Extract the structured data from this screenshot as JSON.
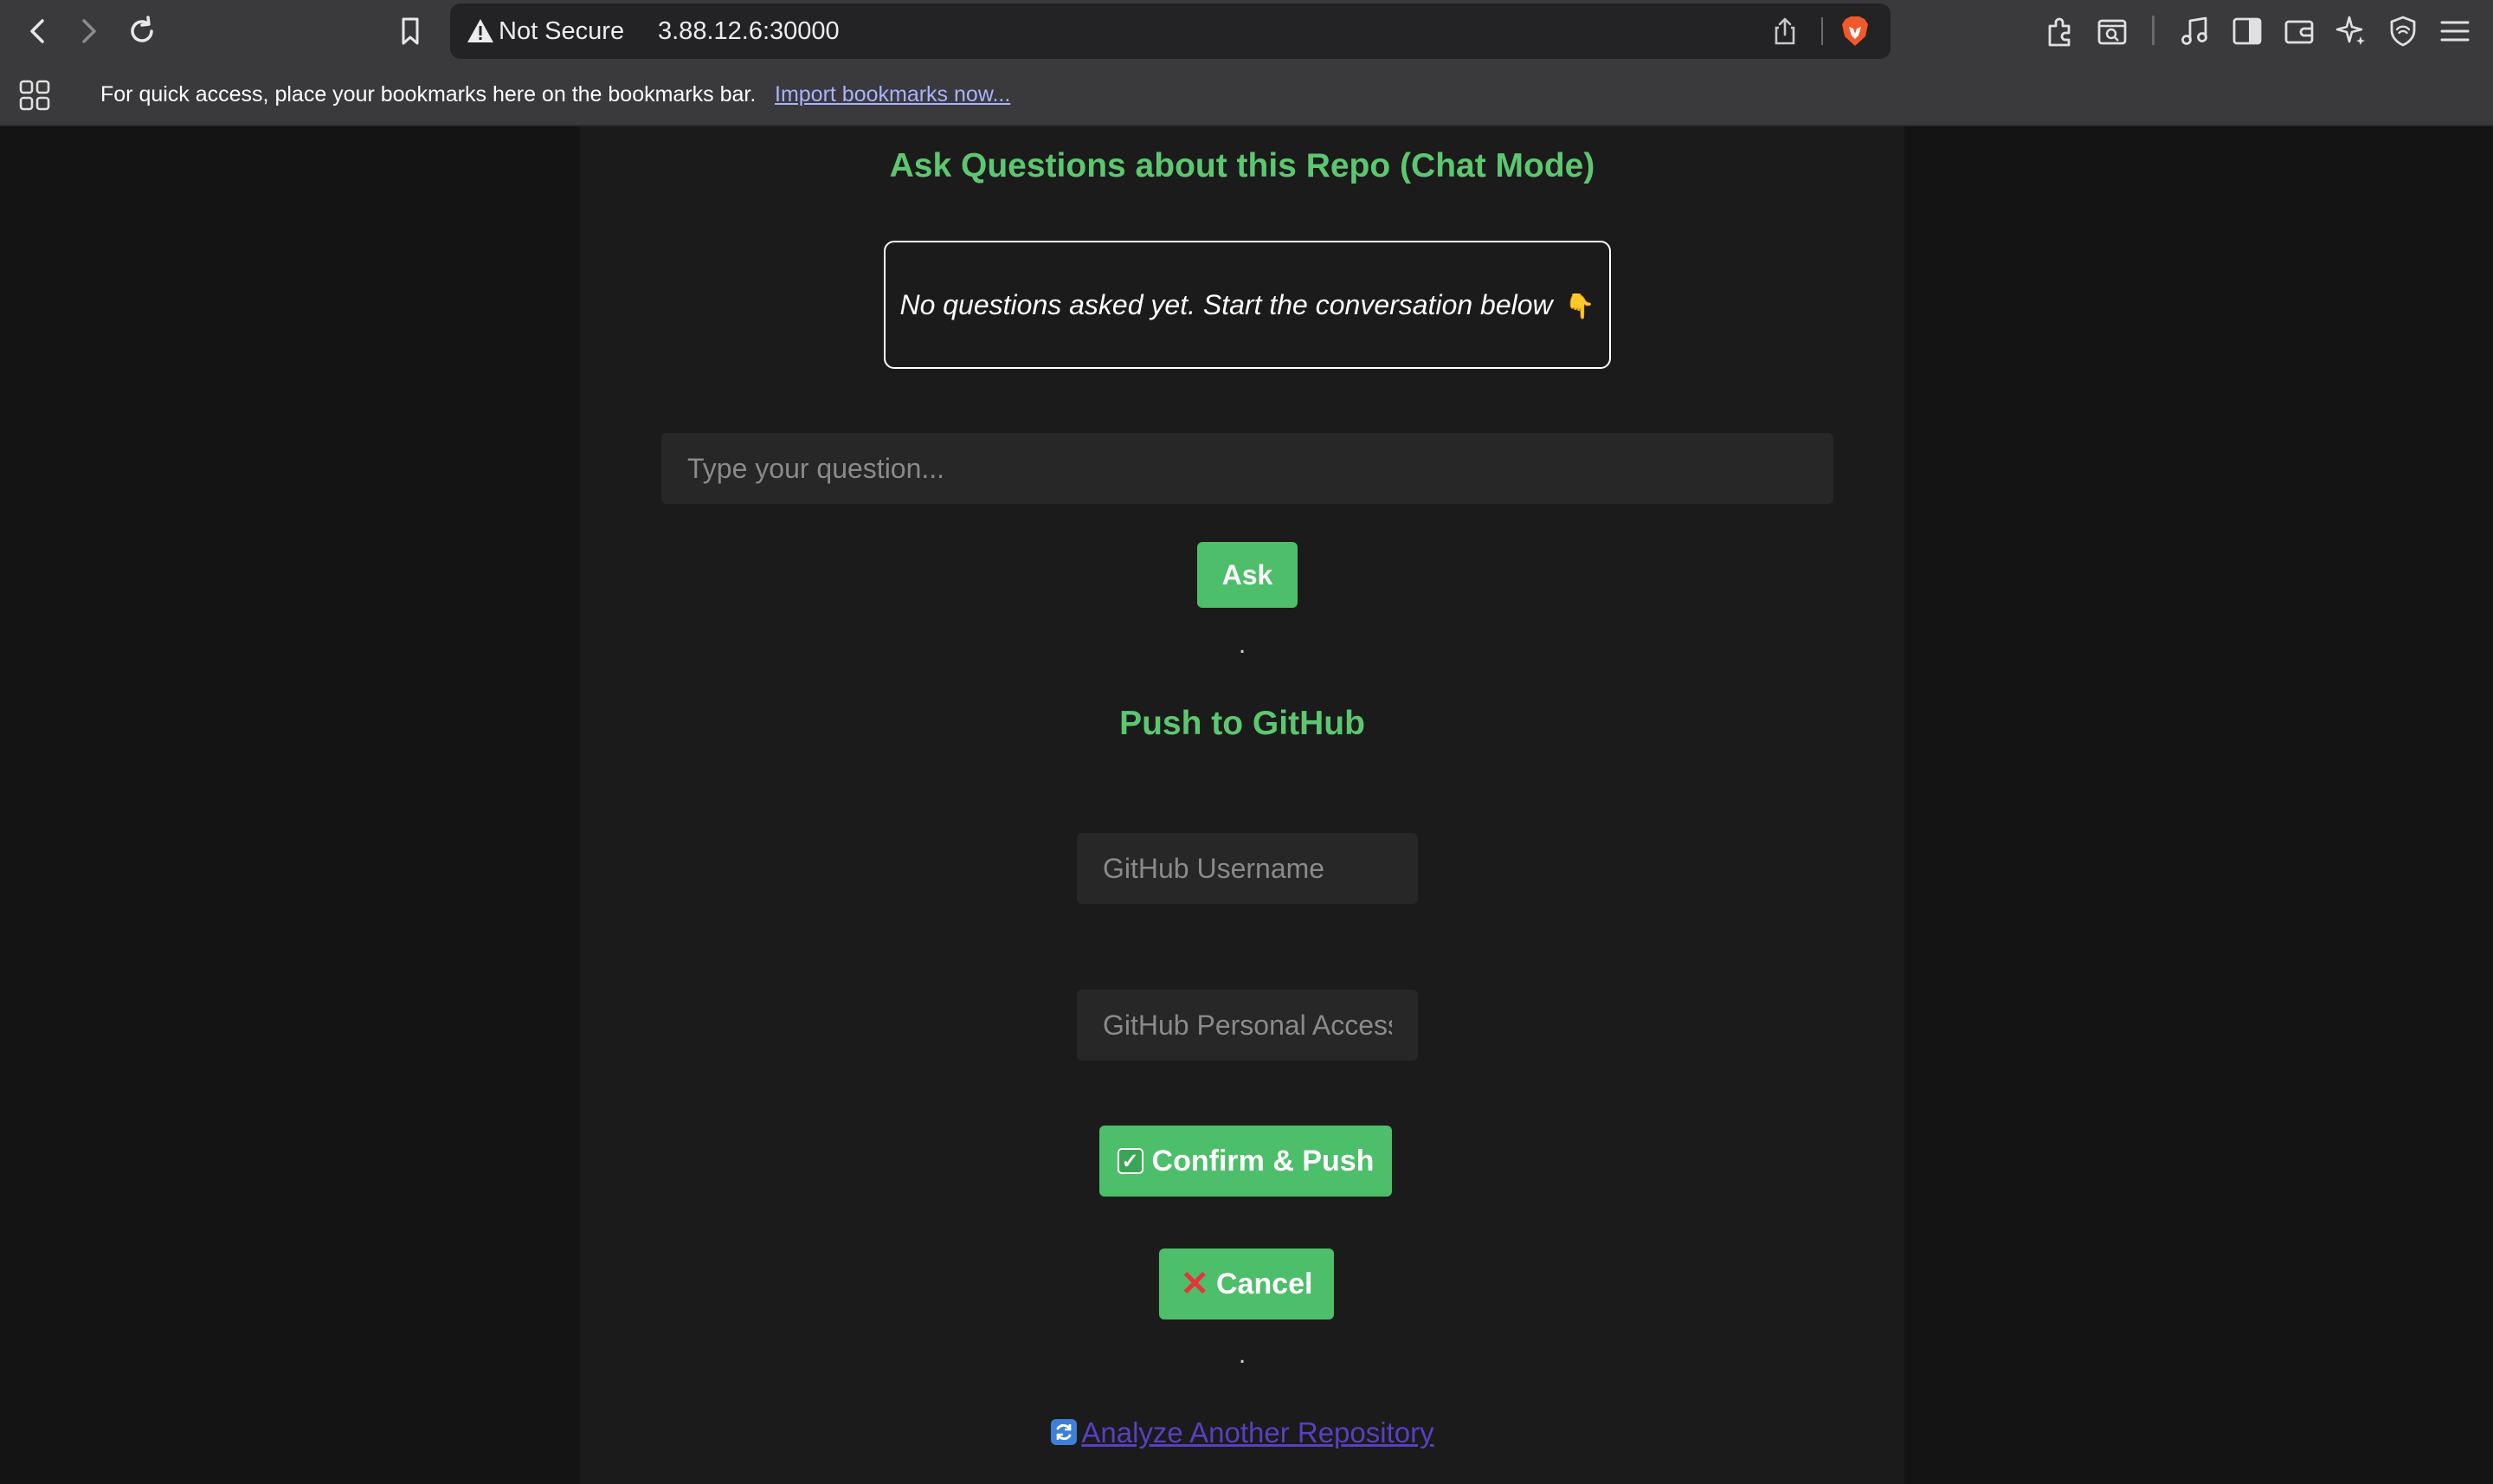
{
  "browser": {
    "security_status": "Not Secure",
    "url": "3.88.12.6:30000",
    "bookmarks_bar_message": "For quick access, place your bookmarks here on the bookmarks bar.",
    "import_bookmarks_link": "Import bookmarks now..."
  },
  "chat": {
    "title": "Ask Questions about this Repo (Chat Mode)",
    "empty_message": "No questions asked yet. Start the conversation below",
    "empty_icon": "pointing-down-emoji",
    "question_placeholder": "Type your question...",
    "ask_label": "Ask",
    "separator": "."
  },
  "push": {
    "title": "Push to GitHub",
    "username_placeholder": "GitHub Username",
    "token_placeholder": "GitHub Personal Access Token",
    "confirm_label": "Confirm & Push",
    "cancel_label": "Cancel",
    "separator": "."
  },
  "footer": {
    "analyze_label": "Analyze Another Repository"
  },
  "colors": {
    "accent_green": "#5cc770",
    "button_green": "#4dbe6a",
    "link_purple": "#5a3fc0",
    "background": "#1b1b1b"
  }
}
